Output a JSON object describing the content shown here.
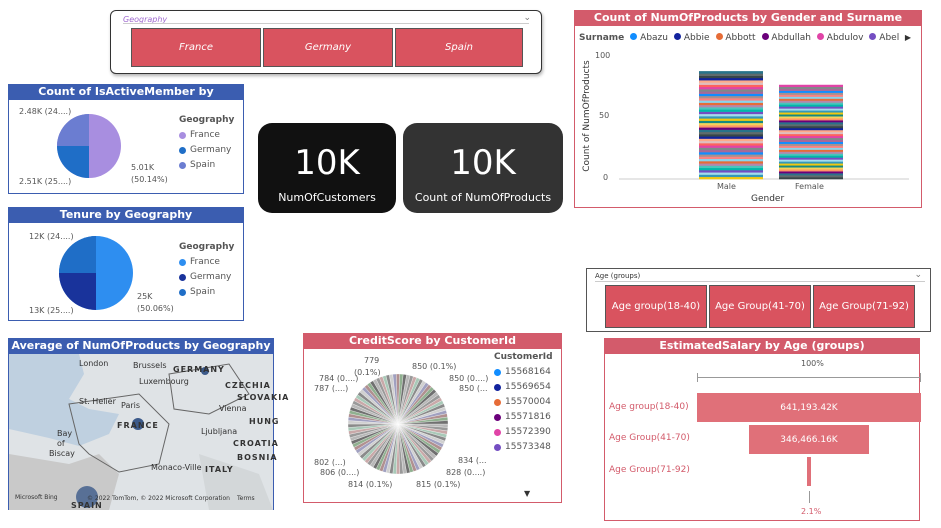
{
  "geo_slicer": {
    "title": "Geography",
    "buttons": [
      "France",
      "Germany",
      "Spain"
    ]
  },
  "active_member": {
    "title": "Count of IsActiveMember by Geography",
    "legend_title": "Geography",
    "legend": [
      {
        "name": "France",
        "color": "#a88ee0"
      },
      {
        "name": "Germany",
        "color": "#1f6ec7"
      },
      {
        "name": "Spain",
        "color": "#6b7dd1"
      }
    ],
    "labels": [
      "2.48K (24....)",
      "2.51K (25....)",
      "5.01K",
      "(50.14%)"
    ]
  },
  "card_customers": {
    "value": "10K",
    "label": "NumOfCustomers"
  },
  "card_products": {
    "value": "10K",
    "label": "Count of NumOfProducts"
  },
  "tenure": {
    "title": "Tenure by Geography",
    "legend_title": "Geography",
    "legend": [
      {
        "name": "France",
        "color": "#2e8ef0"
      },
      {
        "name": "Germany",
        "color": "#19339b"
      },
      {
        "name": "Spain",
        "color": "#1f6ec7"
      }
    ],
    "labels": [
      "12K (24....)",
      "13K (25....)",
      "25K",
      "(50.06%)"
    ]
  },
  "gender_chart": {
    "title": "Count of NumOfProducts by Gender and Surname",
    "legend_title": "Surname",
    "legend": [
      {
        "name": "Abazu",
        "color": "#118dff"
      },
      {
        "name": "Abbie",
        "color": "#12239e"
      },
      {
        "name": "Abbott",
        "color": "#e66c37"
      },
      {
        "name": "Abdullah",
        "color": "#6b007b"
      },
      {
        "name": "Abdulov",
        "color": "#e044a7"
      },
      {
        "name": "Abel",
        "color": "#744ec2"
      }
    ],
    "more_arrow": "▶",
    "ylabel": "Count of NumOfProducts",
    "xlabel": "Gender",
    "yticks": [
      "100",
      "50",
      "0"
    ]
  },
  "chart_data": {
    "type": "bar",
    "categories": [
      "Male",
      "Female"
    ],
    "values": [
      87,
      76
    ],
    "ylim": [
      0,
      100
    ]
  },
  "age_slicer": {
    "title": "Age (groups)",
    "buttons": [
      "Age group(18-40)",
      "Age Group(41-70)",
      "Age Group(71-92)"
    ]
  },
  "map": {
    "title": "Average of NumOfProducts by Geography",
    "labels": [
      "London",
      "Brussels",
      "GERMANY",
      "Luxembourg",
      "CZECHIA",
      "St. Helier",
      "Paris",
      "Vienna",
      "SLOVAKIA",
      "Bay",
      "of",
      "Biscay",
      "FRANCE",
      "Ljubljana",
      "HUNG",
      "CROATIA",
      "Monaco-Ville",
      "ITALY",
      "BOSNIA",
      "SPAIN"
    ],
    "footer": "© 2022 TomTom, © 2022 Microsoft Corporation",
    "terms": "Terms",
    "bing": "Microsoft Bing"
  },
  "credit": {
    "title": "CreditScore by CustomerId",
    "legend_title": "CustomerId",
    "legend": [
      {
        "name": "15568164",
        "color": "#118dff"
      },
      {
        "name": "15569654",
        "color": "#12239e"
      },
      {
        "name": "15570004",
        "color": "#e66c37"
      },
      {
        "name": "15571816",
        "color": "#6b007b"
      },
      {
        "name": "15572390",
        "color": "#e044a7"
      },
      {
        "name": "15573348",
        "color": "#744ec2"
      }
    ],
    "more": "▼",
    "labels": [
      "779",
      "(0.1%)",
      "784 (0....)",
      "787 (....)",
      "850 (0.1%)",
      "850 (0....)",
      "850 (...",
      "802 (...)",
      "806 (0....)",
      "814 (0.1%)",
      "815 (0.1%)",
      "828 (0....)",
      "834 (..."
    ]
  },
  "salary": {
    "title": "EstimatedSalary by Age (groups)",
    "top_pct": "100%",
    "bottom_pct": "2.1%",
    "rows": [
      {
        "label": "Age group(18-40)",
        "value": "641,193.42K",
        "frac": 1.0
      },
      {
        "label": "Age Group(41-70)",
        "value": "346,466.16K",
        "frac": 0.54
      },
      {
        "label": "Age Group(71-92)",
        "value": "",
        "frac": 0.021
      }
    ]
  }
}
